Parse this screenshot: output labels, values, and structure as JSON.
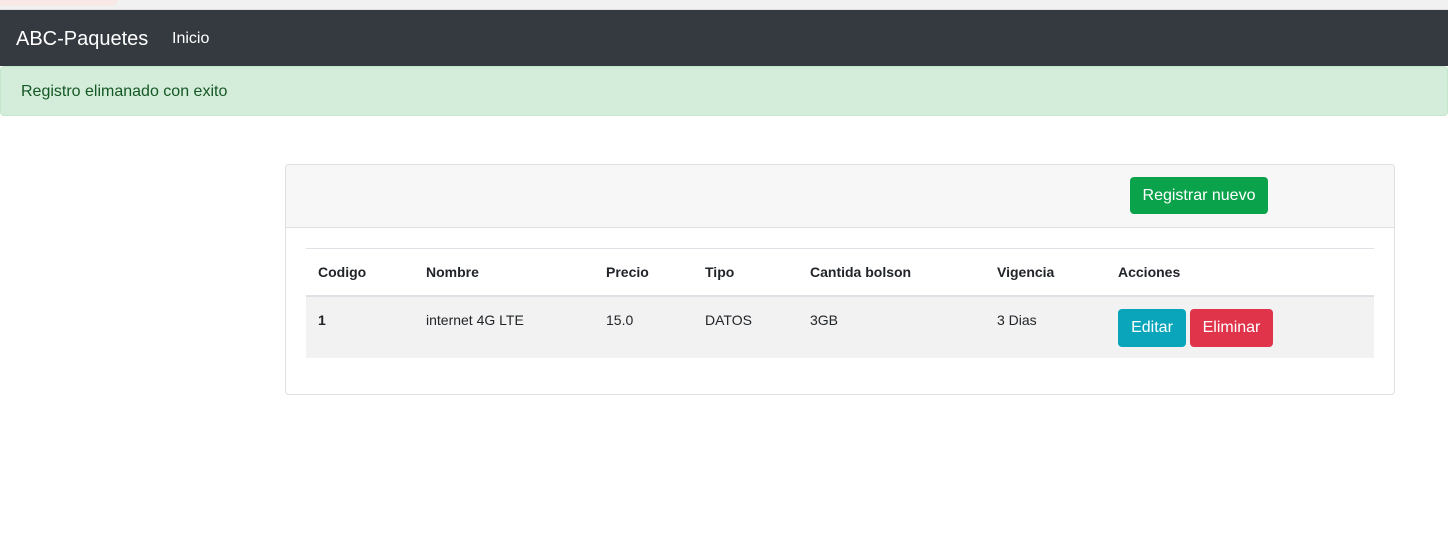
{
  "navbar": {
    "brand": "ABC-Paquetes",
    "links": [
      {
        "label": "Inicio"
      }
    ]
  },
  "alert": {
    "message": "Registro elimanado con exito",
    "color": "#d4edda"
  },
  "toolbar": {
    "new_label": "Registrar nuevo",
    "new_color": "#0aa24b"
  },
  "table": {
    "columns": [
      "Codigo",
      "Nombre",
      "Precio",
      "Tipo",
      "Cantida bolson",
      "Vigencia",
      "Acciones"
    ],
    "rows": [
      {
        "codigo": "1",
        "nombre": "internet 4G LTE",
        "precio": "15.0",
        "tipo": "DATOS",
        "cantidad": "3GB",
        "vigencia": "3 Dias",
        "edit_label": "Editar",
        "delete_label": "Eliminar"
      }
    ]
  },
  "colors": {
    "navbar": "#343a40",
    "edit": "#0ba5bb",
    "delete": "#e0344b"
  }
}
